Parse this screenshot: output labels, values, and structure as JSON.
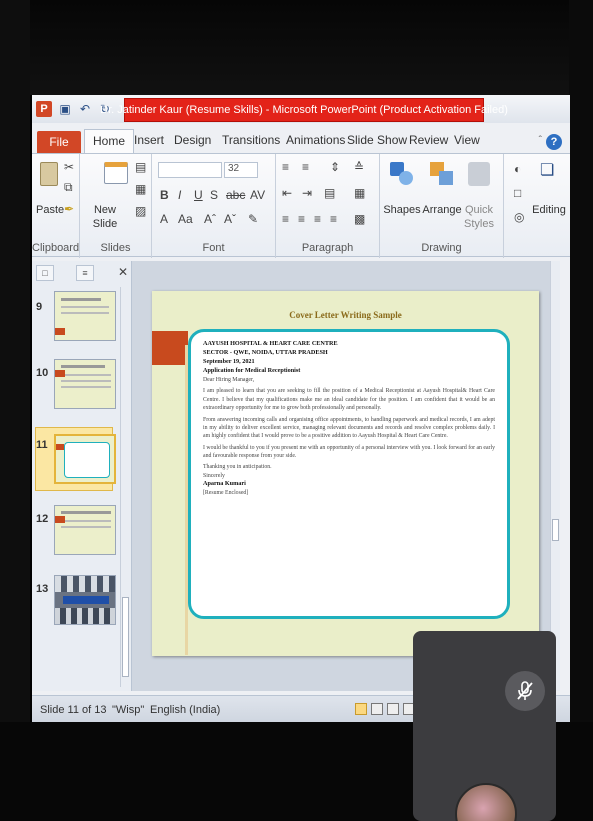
{
  "window": {
    "title": "Dr. Jatinder Kaur (Resume Skills) - Microsoft PowerPoint (Product Activation Failed)"
  },
  "tabs": {
    "file": "File",
    "items": [
      "Home",
      "Insert",
      "Design",
      "Transitions",
      "Animations",
      "Slide Show",
      "Review",
      "View"
    ],
    "active": "Home"
  },
  "ribbon": {
    "clipboard": {
      "paste": "Paste",
      "label": "Clipboard"
    },
    "slides": {
      "new_slide": "New",
      "new_slide2": "Slide",
      "label": "Slides"
    },
    "font": {
      "size": "32",
      "label": "Font"
    },
    "paragraph": {
      "label": "Paragraph"
    },
    "drawing": {
      "shapes": "Shapes",
      "arrange": "Arrange",
      "quick": "Quick",
      "styles": "Styles",
      "label": "Drawing"
    },
    "editing": {
      "label": "Editing"
    }
  },
  "thumbnails": [
    {
      "num": "9"
    },
    {
      "num": "10"
    },
    {
      "num": "11"
    },
    {
      "num": "12"
    },
    {
      "num": "13"
    }
  ],
  "slide": {
    "title": "Cover Letter Writing Sample",
    "hospital": "AAYUSH HOSPITAL & HEART CARE CENTRE",
    "sector": "SECTOR - QWE, NOIDA, UTTAR PRADESH",
    "date": "September 19, 2021",
    "subject": "Application for Medical Receptionist",
    "salutation": "Dear Hiring Manager,",
    "para1": "I am pleased to learn that you are seeking to fill the position of a Medical Receptionist at Aayush Hospital& Heart Care Centre. I believe that my qualifications make me an ideal candidate for the position. I am confident that it would be an extraordinary opportunity for me to grow both professionally and personally.",
    "para2": "From answering incoming calls and organising office appointments, to handling paperwork and medical records, I am adept in my ability to deliver excellent service, managing relevant documents and records and resolve complex problems daily. I am highly confident that I would prove to be a positive addition to Aayush Hospital & Heart Care Centre.",
    "para3": "I would be thankful to you if you present me with an opportunity of a personal interview with you. I look forward for an early and favourable response from your side.",
    "closing1": "Thanking you in anticipation.",
    "closing2": "Sincerely",
    "name": "Aparna Kumari",
    "enclosure": "[Resume Enclosed]"
  },
  "status": {
    "slide": "Slide 11 of 13",
    "theme": "\"Wisp\"",
    "language": "English (India)"
  },
  "colors": {
    "accent": "#d24726",
    "title_warning": "#e32319",
    "letter_border": "#1fb0bd"
  }
}
